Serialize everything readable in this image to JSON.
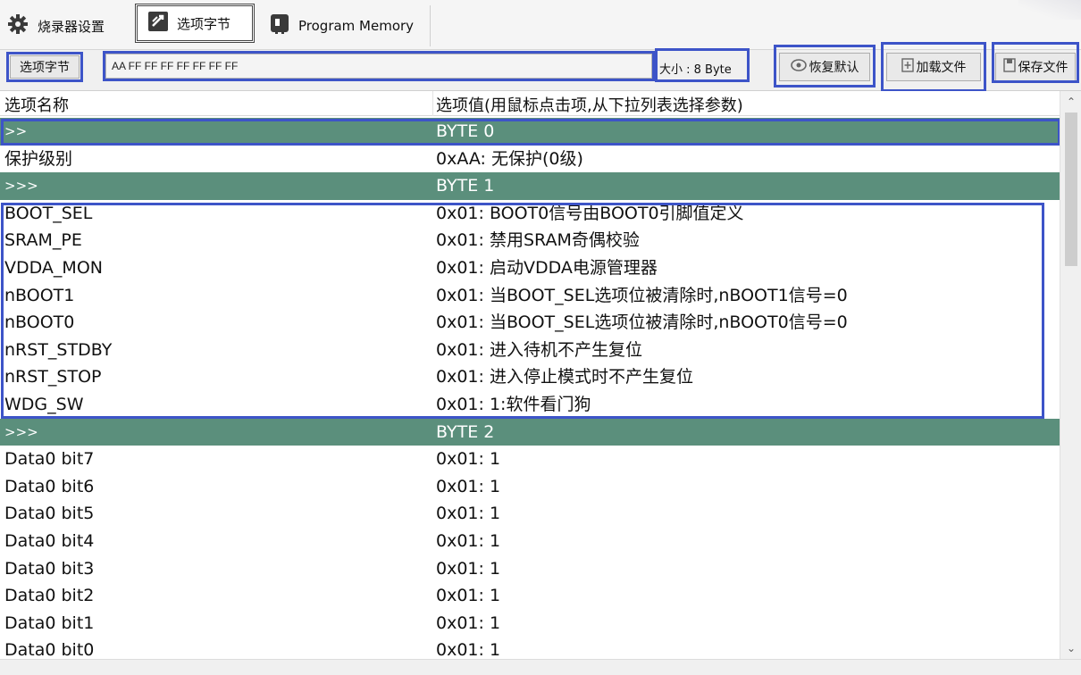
{
  "tabs": [
    {
      "label": "烧录器设置",
      "icon": "gear-icon"
    },
    {
      "label": "选项字节",
      "icon": "option-bytes-icon"
    },
    {
      "label": "Program Memory",
      "icon": "memory-chip-icon"
    }
  ],
  "toolbar": {
    "option_bytes_button": "选项字节",
    "hex_value": "AA FF FF FF FF FF FF FF",
    "size_label": "大小 : 8 Byte",
    "restore_default": "恢复默认",
    "load_file": "加载文件",
    "save_file": "保存文件"
  },
  "grid": {
    "header_name": "选项名称",
    "header_value": "选项值(用鼠标点击项,从下拉列表选择参数)",
    "rows": [
      {
        "type": "section",
        "name": ">>",
        "value": "BYTE 0"
      },
      {
        "type": "item",
        "name": "保护级别",
        "value": "0xAA: 无保护(0级)"
      },
      {
        "type": "section",
        "name": ">>>",
        "value": "BYTE 1"
      },
      {
        "type": "item",
        "name": "BOOT_SEL",
        "value": "0x01: BOOT0信号由BOOT0引脚值定义"
      },
      {
        "type": "item",
        "name": "SRAM_PE",
        "value": "0x01: 禁用SRAM奇偶校验"
      },
      {
        "type": "item",
        "name": "VDDA_MON",
        "value": "0x01: 启动VDDA电源管理器"
      },
      {
        "type": "item",
        "name": "nBOOT1",
        "value": "0x01: 当BOOT_SEL选项位被清除时,nBOOT1信号=0"
      },
      {
        "type": "item",
        "name": "nBOOT0",
        "value": "0x01: 当BOOT_SEL选项位被清除时,nBOOT0信号=0"
      },
      {
        "type": "item",
        "name": "nRST_STDBY",
        "value": "0x01: 进入待机不产生复位"
      },
      {
        "type": "item",
        "name": "nRST_STOP",
        "value": "0x01: 进入停止模式时不产生复位"
      },
      {
        "type": "item",
        "name": "WDG_SW",
        "value": "0x01: 1:软件看门狗"
      },
      {
        "type": "section",
        "name": ">>>",
        "value": "BYTE 2"
      },
      {
        "type": "item",
        "name": "Data0 bit7",
        "value": "0x01: 1"
      },
      {
        "type": "item",
        "name": "Data0 bit6",
        "value": "0x01: 1"
      },
      {
        "type": "item",
        "name": "Data0 bit5",
        "value": "0x01: 1"
      },
      {
        "type": "item",
        "name": "Data0 bit4",
        "value": "0x01: 1"
      },
      {
        "type": "item",
        "name": "Data0 bit3",
        "value": "0x01: 1"
      },
      {
        "type": "item",
        "name": "Data0 bit2",
        "value": "0x01: 1"
      },
      {
        "type": "item",
        "name": "Data0 bit1",
        "value": "0x01: 1"
      },
      {
        "type": "item",
        "name": "Data0 bit0",
        "value": "0x01: 1"
      }
    ]
  },
  "colors": {
    "section_row_bg": "#5b8f7c",
    "highlight_border": "#3d54c8"
  }
}
